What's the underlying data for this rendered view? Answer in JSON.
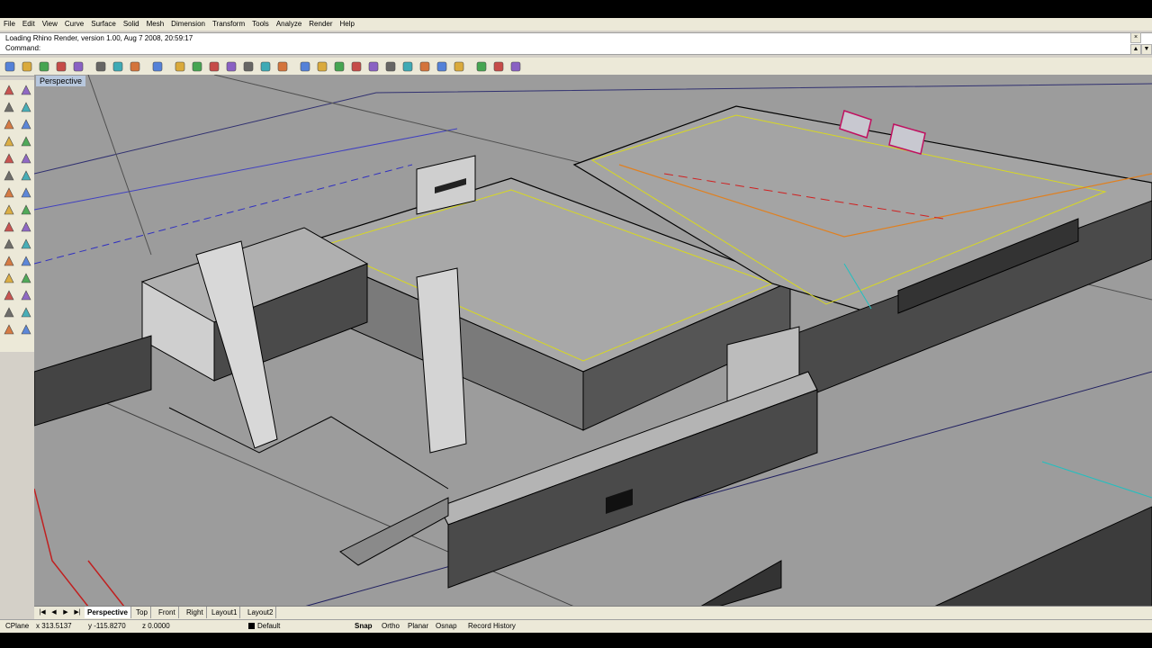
{
  "menu": [
    "File",
    "Edit",
    "View",
    "Curve",
    "Surface",
    "Solid",
    "Mesh",
    "Dimension",
    "Transform",
    "Tools",
    "Analyze",
    "Render",
    "Help"
  ],
  "command": {
    "history": "Loading Rhino Render, version 1.00, Aug  7 2008, 20:59:17",
    "prompt_label": "Command:",
    "value": ""
  },
  "window_controls": [
    "_",
    "□",
    "×"
  ],
  "viewport": {
    "title": "Perspective"
  },
  "view_tabs": [
    "Perspective",
    "Top",
    "Front",
    "Right",
    "Layout1",
    "Layout2"
  ],
  "status": {
    "cplane": "CPlane",
    "x": "x 313.5137",
    "y": "y -115.8270",
    "z": "z 0.0000",
    "layer": "Default",
    "snap": "Snap",
    "ortho": "Ortho",
    "planar": "Planar",
    "osnap": "Osnap",
    "record_history": "Record History"
  },
  "toolbar_icons": [
    "new-icon",
    "open-icon",
    "save-icon",
    "print-icon",
    "import-icon",
    "cut-icon",
    "copy-icon",
    "paste-icon",
    "undo-icon",
    "pan-icon",
    "rotate-view-icon",
    "zoom-dynamic-icon",
    "zoom-window-icon",
    "zoom-extents-icon",
    "zoom-selected-icon",
    "four-views-icon",
    "shaded-icon",
    "render-icon",
    "hide-icon",
    "show-icon",
    "light-icon",
    "lock-icon",
    "layer-color-icon",
    "properties-icon",
    "ghosted-icon",
    "sphere-icon",
    "settings-icon",
    "grid-icon",
    "help-icon"
  ],
  "sidebar_icons": [
    "select-icon",
    "point-icon",
    "polyline-icon",
    "curve-icon",
    "circle-icon",
    "arc-icon",
    "ellipse-icon",
    "rectangle-icon",
    "polygon-icon",
    "freeform-icon",
    "surface-icon",
    "extrude-icon",
    "box-icon",
    "sphere-solid-icon",
    "cylinder-icon",
    "boolean-icon",
    "fillet-icon",
    "trim-icon",
    "split-icon",
    "join-icon",
    "move-icon",
    "copy-object-icon",
    "rotate-icon",
    "scale-icon",
    "mirror-icon",
    "array-icon",
    "text-icon",
    "dimension-icon",
    "mesh-icon",
    "analyze-icon"
  ]
}
